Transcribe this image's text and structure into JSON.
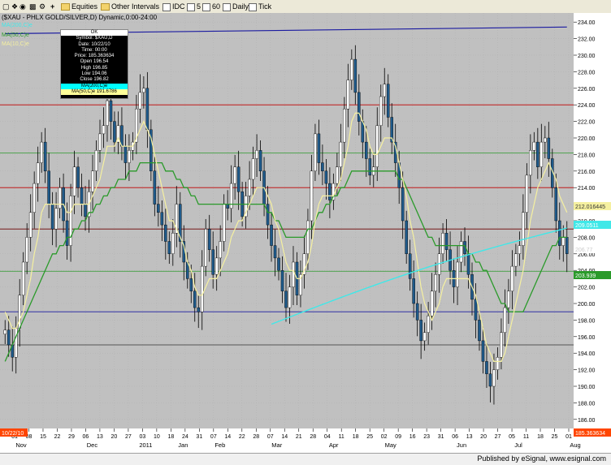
{
  "toolbar": {
    "equities": "Equities",
    "other_intervals": "Other Intervals",
    "idc": "IDC",
    "five": "5",
    "sixty": "60",
    "daily": "Daily",
    "tick": "Tick"
  },
  "chart_title": "($XAU - PHLX GOLD/SILVER,D) Dynamic,0:00-24:00",
  "legend": {
    "ma200": "MA(200,C)e",
    "ma50": "MA(50,C)e",
    "ma10": "MA(10,C)e"
  },
  "tooltip": {
    "ok": "OK",
    "symbol": "Symbol: $XAU,D",
    "date": "Date: 10/22/10",
    "time": "Time: 00:00",
    "price": "Price: 185.363634",
    "open": "Open 196.54",
    "high": "High 196.85",
    "low": "Low 194.06",
    "close": "Close 196.82",
    "ma200": "MA(200,C)e",
    "ma50": "MA(50,C)e 191.6786"
  },
  "value_tags": {
    "ma10": "212.016445",
    "ma200": "209.0511",
    "close": "206.77",
    "ma50": "203.939",
    "cursor": "185.363634"
  },
  "x_axis": {
    "cursor_date": "10/22/10"
  },
  "status": "Published by eSignal, www.esignal.com",
  "colors": {
    "background": "#c0c0c0",
    "up_candle": "#ffffff",
    "down_candle": "#1f5a8a",
    "ma10": "#f5f0a0",
    "ma50": "#2a9a2a",
    "ma200": "#40e8e8",
    "long_ma": "#1a1aa0",
    "cursor_tag": "#ff4500"
  },
  "chart_data": {
    "type": "candlestick",
    "title": "($XAU - PHLX GOLD/SILVER,D) Dynamic,0:00-24:00",
    "ylim": [
      185,
      235
    ],
    "yticks": [
      186,
      188,
      190,
      192,
      194,
      196,
      198,
      200,
      202,
      204,
      206,
      208,
      210,
      212,
      214,
      216,
      218,
      220,
      222,
      224,
      226,
      228,
      230,
      232,
      234
    ],
    "xtick_labels": [
      "01",
      "08",
      "15",
      "22",
      "29",
      "06",
      "13",
      "20",
      "27",
      "03",
      "10",
      "18",
      "24",
      "31",
      "07",
      "14",
      "22",
      "28",
      "07",
      "14",
      "21",
      "28",
      "04",
      "11",
      "18",
      "25",
      "02",
      "09",
      "16",
      "23",
      "31",
      "06",
      "13",
      "20",
      "27",
      "05",
      "11",
      "18",
      "25",
      "01"
    ],
    "month_labels": [
      "Nov",
      "Dec",
      "2011",
      "Jan",
      "Feb",
      "Mar",
      "Apr",
      "May",
      "Jun",
      "Jul",
      "Aug"
    ],
    "horizontal_lines": [
      {
        "value": 224.0,
        "color": "#c00000"
      },
      {
        "value": 218.2,
        "color": "#2a9a2a"
      },
      {
        "value": 214.0,
        "color": "#c00000"
      },
      {
        "value": 209.0,
        "color": "#6b0000"
      },
      {
        "value": 203.9,
        "color": "#2a9a2a"
      },
      {
        "value": 199.0,
        "color": "#1a1aa0"
      },
      {
        "value": 195.0,
        "color": "#333333"
      }
    ],
    "close": [
      196.8,
      195.0,
      193.5,
      197.0,
      201.0,
      205.0,
      208.0,
      211.0,
      214.5,
      217.0,
      219.5,
      216.0,
      212.0,
      209.0,
      211.5,
      214.0,
      210.0,
      207.0,
      213.0,
      216.5,
      214.0,
      212.0,
      210.5,
      213.5,
      216.0,
      218.5,
      220.5,
      221.5,
      224.5,
      222.0,
      219.5,
      221.5,
      219.0,
      217.0,
      218.5,
      219.5,
      223.5,
      225.5,
      226.0,
      221.0,
      216.0,
      212.0,
      211.0,
      209.5,
      207.5,
      206.0,
      208.5,
      212.0,
      207.5,
      205.0,
      203.0,
      201.5,
      199.5,
      199.0,
      204.5,
      209.0,
      206.5,
      203.5,
      205.5,
      207.5,
      212.0,
      211.5,
      214.5,
      216.5,
      213.5,
      210.5,
      213.0,
      215.0,
      217.5,
      218.5,
      216.0,
      212.0,
      209.5,
      207.0,
      205.5,
      204.0,
      201.5,
      199.5,
      202.0,
      205.0,
      201.0,
      203.5,
      206.0,
      210.0,
      216.0,
      220.5,
      217.0,
      216.0,
      214.5,
      212.5,
      214.5,
      216.5,
      219.5,
      223.5,
      227.0,
      229.5,
      225.5,
      222.0,
      219.5,
      217.5,
      215.5,
      216.5,
      221.5,
      225.0,
      226.5,
      222.5,
      219.5,
      217.0,
      214.0,
      210.0,
      206.0,
      203.0,
      200.0,
      198.0,
      195.5,
      196.5,
      198.5,
      201.5,
      203.5,
      206.0,
      208.5,
      206.5,
      204.0,
      202.0,
      205.0,
      207.5,
      206.0,
      203.5,
      200.5,
      198.0,
      195.5,
      193.0,
      191.5,
      190.0,
      192.0,
      193.5,
      196.5,
      199.5,
      201.5,
      204.5,
      206.0,
      207.0,
      211.0,
      215.5,
      218.5,
      219.5,
      216.5,
      219.5,
      220.0,
      217.5,
      214.0,
      210.0,
      207.0,
      208.0,
      206.0
    ],
    "series": [
      {
        "name": "MA(10,C)e",
        "values": [
          199,
          198,
          197,
          197,
          198,
          199,
          201,
          203,
          206,
          208,
          211,
          212,
          212,
          212,
          212,
          212,
          212,
          211,
          211,
          212,
          212,
          212,
          212,
          212,
          213,
          214,
          215,
          217,
          219,
          219,
          219,
          220,
          219,
          219,
          219,
          219,
          220,
          221,
          222,
          221,
          220,
          218,
          216,
          214,
          212,
          210,
          210,
          209,
          208,
          207,
          205,
          204,
          202,
          201,
          201,
          202,
          203,
          203,
          203,
          204,
          205,
          206,
          208,
          209,
          210,
          210,
          211,
          212,
          213,
          214,
          214,
          214,
          213,
          212,
          210,
          209,
          207,
          205,
          204,
          204,
          203,
          203,
          204,
          205,
          207,
          210,
          212,
          213,
          213,
          213,
          213,
          214,
          215,
          217,
          219,
          222,
          223,
          223,
          222,
          221,
          219,
          218,
          218,
          219,
          220,
          220,
          220,
          219,
          217,
          215,
          213,
          210,
          208,
          205,
          202,
          200,
          199,
          198,
          199,
          200,
          202,
          203,
          203,
          203,
          203,
          203,
          203,
          203,
          202,
          201,
          199,
          197,
          195,
          194,
          193,
          193,
          193,
          194,
          196,
          198,
          200,
          202,
          204,
          207,
          210,
          212,
          214,
          215,
          216,
          217,
          216,
          215,
          213,
          212,
          211,
          210,
          210
        ]
      },
      {
        "name": "MA(50,C)e",
        "values": [
          193,
          194,
          195,
          196,
          197,
          198,
          199,
          200,
          201,
          202,
          203,
          204,
          205,
          206,
          206,
          207,
          207,
          208,
          208,
          209,
          209,
          210,
          210,
          211,
          211,
          212,
          212,
          213,
          213,
          214,
          214,
          215,
          215,
          215,
          216,
          216,
          216,
          217,
          217,
          217,
          217,
          217,
          217,
          217,
          216,
          216,
          216,
          215,
          215,
          214,
          214,
          213,
          213,
          212,
          212,
          212,
          212,
          212,
          212,
          212,
          212,
          212,
          212,
          212,
          212,
          212,
          212,
          212,
          212,
          212,
          212,
          212,
          211,
          211,
          210,
          210,
          209,
          208,
          208,
          208,
          208,
          208,
          208,
          209,
          209,
          210,
          211,
          211,
          212,
          212,
          213,
          213,
          214,
          214,
          215,
          216,
          216,
          216,
          216,
          216,
          216,
          216,
          216,
          216,
          216,
          216,
          216,
          216,
          215,
          215,
          214,
          213,
          212,
          211,
          210,
          209,
          208,
          208,
          207,
          207,
          207,
          207,
          207,
          207,
          207,
          207,
          207,
          206,
          206,
          205,
          205,
          204,
          204,
          203,
          202,
          201,
          200,
          200,
          199,
          199,
          199,
          199,
          199,
          200,
          201,
          202,
          203,
          204,
          205,
          206,
          207,
          207,
          208,
          208,
          208,
          208,
          208
        ]
      },
      {
        "name": "MA(200,C)e",
        "values": []
      }
    ]
  }
}
